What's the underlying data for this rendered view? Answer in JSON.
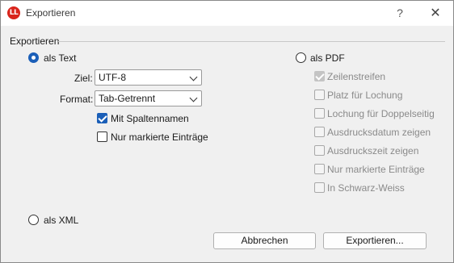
{
  "window": {
    "title": "Exportieren",
    "app_icon_text": "LL",
    "help_label": "?",
    "close_label": "✕"
  },
  "group": {
    "label": "Exportieren"
  },
  "text_option": {
    "label": "als Text",
    "checked": true,
    "ziel": {
      "label": "Ziel:",
      "value": "UTF-8"
    },
    "format": {
      "label": "Format:",
      "value": "Tab-Getrennt"
    },
    "mit_spaltennamen": {
      "label": "Mit Spaltennamen",
      "checked": true
    },
    "nur_markierte": {
      "label": "Nur markierte Einträge",
      "checked": false
    }
  },
  "pdf_option": {
    "label": "als PDF",
    "checked": false,
    "options": [
      {
        "label": "Zeilenstreifen",
        "checked": true,
        "disabled": true
      },
      {
        "label": "Platz für Lochung",
        "checked": false,
        "disabled": true
      },
      {
        "label": "Lochung für Doppelseitig",
        "checked": false,
        "disabled": true
      },
      {
        "label": "Ausdrucksdatum zeigen",
        "checked": false,
        "disabled": true
      },
      {
        "label": "Ausdruckszeit zeigen",
        "checked": false,
        "disabled": true
      },
      {
        "label": "Nur markierte Einträge",
        "checked": false,
        "disabled": true
      },
      {
        "label": "In Schwarz-Weiss",
        "checked": false,
        "disabled": true
      }
    ]
  },
  "xml_option": {
    "label": "als XML",
    "checked": false
  },
  "buttons": {
    "cancel": "Abbrechen",
    "export": "Exportieren..."
  },
  "colors": {
    "accent": "#1b5fb8",
    "app_icon": "#d9251c"
  }
}
